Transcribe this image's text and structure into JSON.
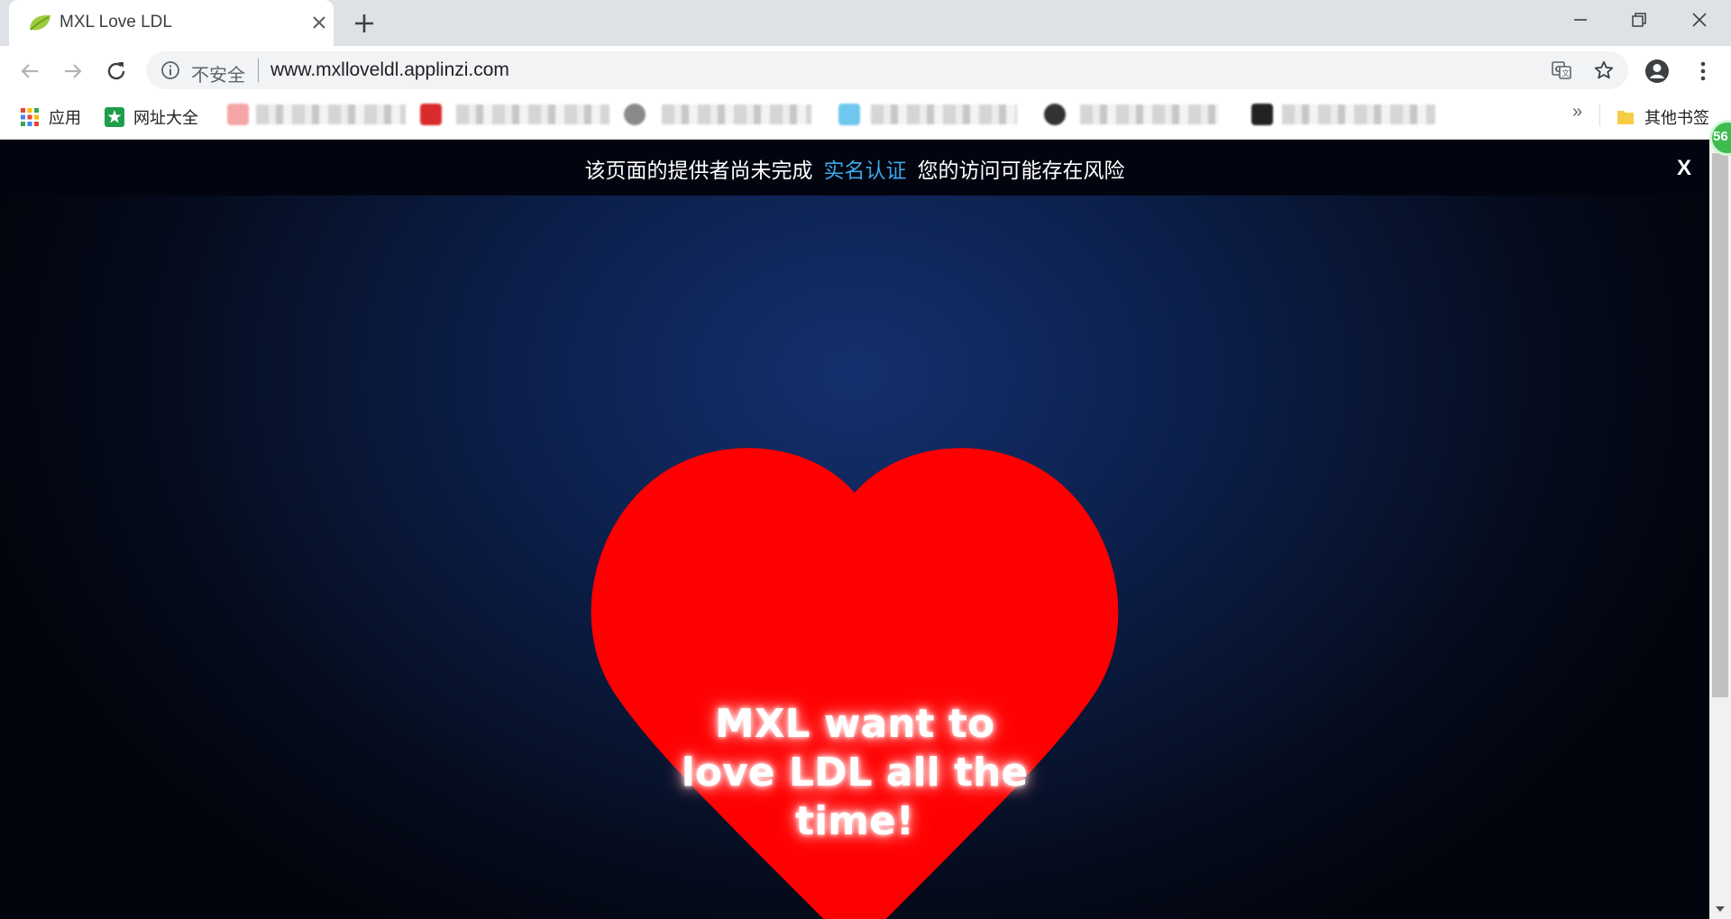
{
  "browser": {
    "tab": {
      "title": "MXL Love LDL",
      "favicon": "leaf-icon"
    },
    "window_controls": [
      "minimize-icon",
      "restore-icon",
      "close-icon"
    ],
    "address_bar": {
      "security_label": "不安全",
      "url": "www.mxlloveldl.applinzi.com"
    },
    "bookmarks": {
      "apps_label": "应用",
      "item1_label": "网址大全",
      "other_label": "其他书签",
      "overflow_label": "»"
    },
    "extension_badge": "56"
  },
  "page": {
    "warning": {
      "text_before": "该页面的提供者尚未完成",
      "link": "实名认证",
      "text_after": "您的访问可能存在风险",
      "close": "X"
    },
    "message": "MXL want to love LDL all the time!"
  },
  "colors": {
    "heart": "#ff0000",
    "background": "#0c1f4a",
    "link": "#3ea7e8",
    "tabstrip": "#dee1e6"
  }
}
